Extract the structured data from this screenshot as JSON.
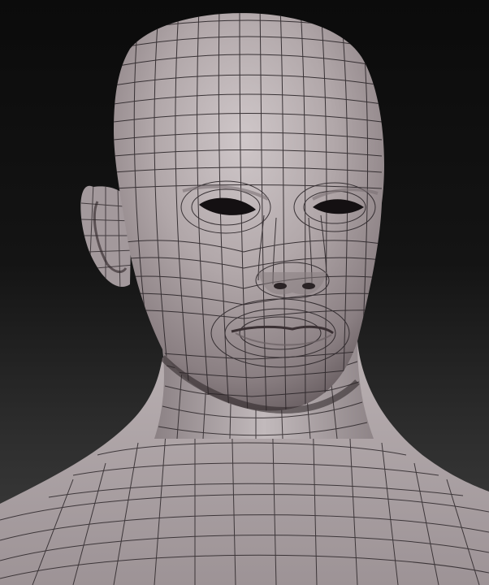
{
  "scene": {
    "subject": "wireframe-head-bust",
    "colors": {
      "background_top": "#0b0b0b",
      "background_bottom": "#3f3f3f",
      "skin_light": "#c9c1c3",
      "skin_mid": "#a79d9f",
      "skin_dark": "#6e6466",
      "wire": "#2b2528",
      "cavity": "#141012"
    }
  }
}
